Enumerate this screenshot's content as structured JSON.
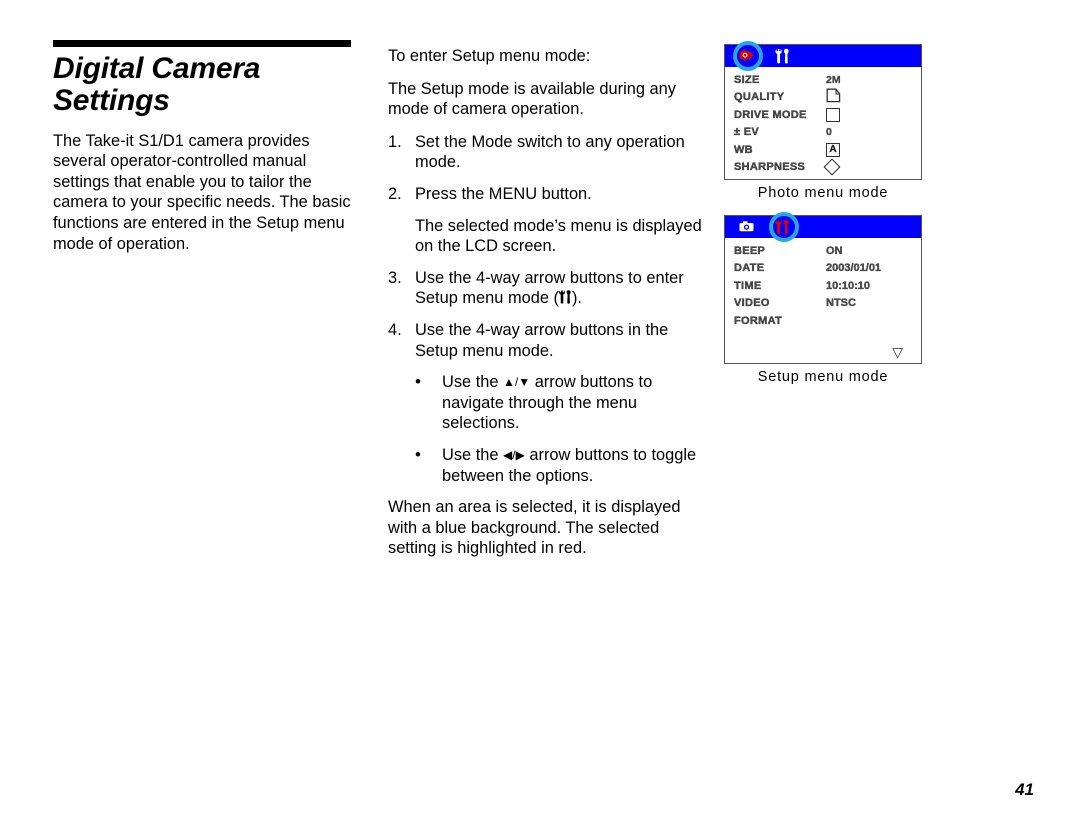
{
  "page": {
    "number": "41"
  },
  "left_column": {
    "title_line1": "Digital  Camera",
    "title_line2": "Settings",
    "intro_paragraph": "The Take-it S1/D1 camera provides several operator-controlled manual settings that enable you to tailor the camera to your specific needs. The basic functions are entered in the Setup menu mode of operation."
  },
  "middle_column": {
    "lead_in": "To enter Setup menu mode:",
    "availability": "The Setup mode is available during any mode of camera operation.",
    "steps": [
      {
        "num": "1.",
        "text": "Set the Mode switch to any operation mode."
      },
      {
        "num": "2.",
        "text": "Press the MENU button."
      }
    ],
    "step2_note": "The selected mode’s menu is displayed on the LCD screen.",
    "step3": {
      "num": "3.",
      "text_before": "Use the 4-way arrow buttons to enter Setup menu mode (",
      "icon": "setup-tools-icon",
      "text_after": ")."
    },
    "step4": {
      "num": "4.",
      "text": "Use the 4-way arrow buttons in the Setup menu mode."
    },
    "bullets": [
      {
        "marker": "•",
        "text_before": "Use the ",
        "arrows": "▲/▼",
        "text_after": " arrow buttons to navigate through the menu selections."
      },
      {
        "marker": "•",
        "text_before": "Use the ",
        "arrows": "◀/▶",
        "text_after": " arrow buttons to toggle between the options."
      }
    ],
    "closing_paragraph": "When an area is selected, it is displayed with a blue background. The selected setting is highlighted in red."
  },
  "screens": [
    {
      "id": "photo-menu-screen",
      "caption": "Photo  menu  mode",
      "header": {
        "bg_color": "#0000ff",
        "icons": [
          {
            "name": "camera-icon",
            "color": "#e00000",
            "highlighted": true
          },
          {
            "name": "setup-tools-icon",
            "color": "#ffffff",
            "highlighted": false
          }
        ]
      },
      "rows": [
        {
          "label": "SIZE",
          "value": "2M",
          "value_type": "text"
        },
        {
          "label": "QUALITY",
          "value": "",
          "value_type": "quality-page-icon"
        },
        {
          "label": "DRIVE MODE",
          "value": "",
          "value_type": "square-icon"
        },
        {
          "label": "± EV",
          "value": "0",
          "value_type": "text"
        },
        {
          "label": "WB",
          "value": "A",
          "value_type": "boxed-letter-icon"
        },
        {
          "label": "SHARPNESS",
          "value": "",
          "value_type": "diamond-icon"
        }
      ],
      "footer_arrow": ""
    },
    {
      "id": "setup-menu-screen",
      "caption": "Setup  menu  mode",
      "header": {
        "bg_color": "#0000ff",
        "icons": [
          {
            "name": "camera-icon",
            "color": "#ffffff",
            "highlighted": false
          },
          {
            "name": "setup-tools-icon",
            "color": "#e00000",
            "highlighted": true
          }
        ]
      },
      "rows": [
        {
          "label": "BEEP",
          "value": "ON",
          "value_type": "text"
        },
        {
          "label": "DATE",
          "value": "2003/01/01",
          "value_type": "text"
        },
        {
          "label": "TIME",
          "value": "10:10:10",
          "value_type": "text"
        },
        {
          "label": "VIDEO",
          "value": "NTSC",
          "value_type": "text"
        },
        {
          "label": "FORMAT",
          "value": "",
          "value_type": "text"
        }
      ],
      "footer_arrow": "▽"
    }
  ],
  "colors": {
    "lcd_header_blue": "#0000ff",
    "highlight_ring_cyan": "#29a8e0",
    "selected_red": "#e00000"
  }
}
